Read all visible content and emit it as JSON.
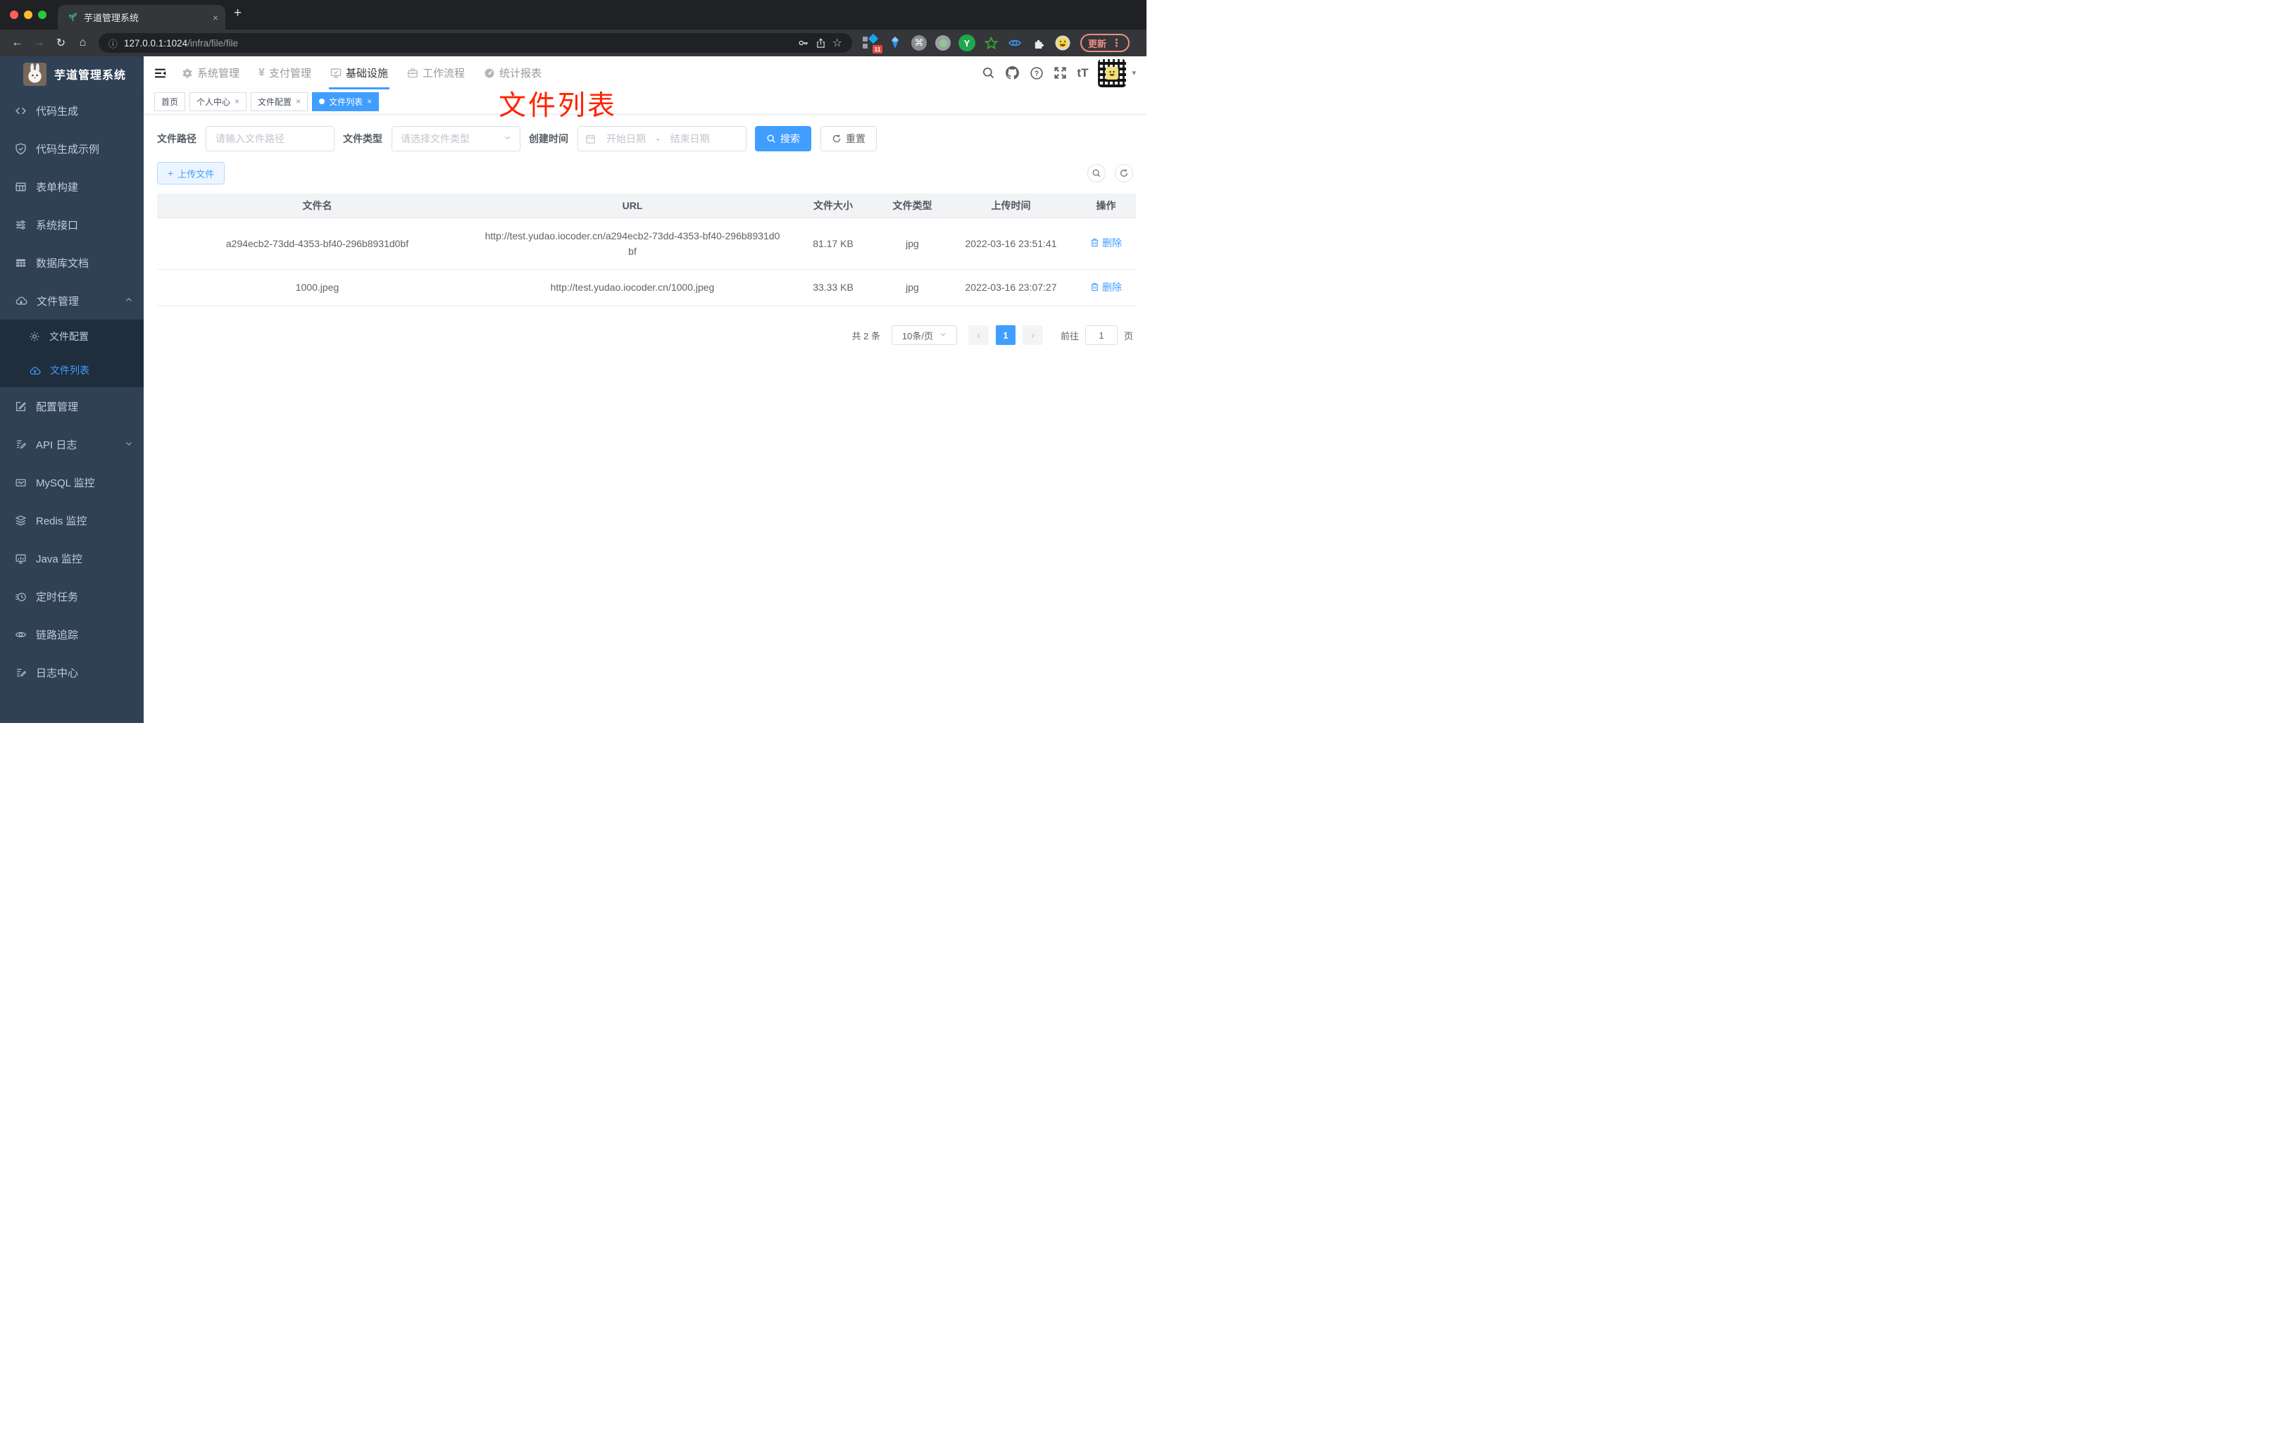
{
  "colors": {
    "accent": "#409eff",
    "sidebar_bg": "#304156",
    "submenu_bg": "#1f2d3d",
    "annotation_red": "#ff2301",
    "table_header_bg": "#f2f3f5"
  },
  "browser": {
    "tab_title": "芋道管理系统",
    "url_host": "127.0.0.1:1024",
    "url_path": "/infra/file/file",
    "update_label": "更新",
    "extensions": [
      {
        "name": "extension-badge",
        "badge": "11"
      },
      {
        "name": "extension-command",
        "char": "⌘"
      },
      {
        "name": "extension-y",
        "char": "Y"
      }
    ]
  },
  "icons": {
    "close": "×",
    "plus": "+",
    "back": "←",
    "forward": "→",
    "reload": "↻",
    "home": "⌂",
    "info": "ⓘ",
    "star": "☆",
    "kebab": "⋮",
    "caret": "▾",
    "chevron_left": "‹",
    "chevron_right": "›",
    "question": "?",
    "yen": "¥",
    "font_size": "tT"
  },
  "sidebar": {
    "title": "芋道管理系统",
    "items": [
      {
        "label": "代码生成"
      },
      {
        "label": "代码生成示例"
      },
      {
        "label": "表单构建"
      },
      {
        "label": "系统接口"
      },
      {
        "label": "数据库文档"
      },
      {
        "label": "文件管理",
        "children": [
          {
            "label": "文件配置"
          },
          {
            "label": "文件列表"
          }
        ]
      },
      {
        "label": "配置管理"
      },
      {
        "label": "API 日志"
      },
      {
        "label": "MySQL 监控"
      },
      {
        "label": "Redis 监控"
      },
      {
        "label": "Java 监控"
      },
      {
        "label": "定时任务"
      },
      {
        "label": "链路追踪"
      },
      {
        "label": "日志中心"
      }
    ]
  },
  "header": {
    "nav": [
      {
        "label": "系统管理"
      },
      {
        "label": "支付管理"
      },
      {
        "label": "基础设施"
      },
      {
        "label": "工作流程"
      },
      {
        "label": "统计报表"
      }
    ]
  },
  "tags": [
    {
      "label": "首页"
    },
    {
      "label": "个人中心"
    },
    {
      "label": "文件配置"
    },
    {
      "label": "文件列表"
    }
  ],
  "annotation": {
    "text": "文件列表"
  },
  "filters": {
    "path_label": "文件路径",
    "path_placeholder": "请输入文件路径",
    "type_label": "文件类型",
    "type_placeholder": "请选择文件类型",
    "date_label": "创建时间",
    "date_start_placeholder": "开始日期",
    "date_separator": "-",
    "date_end_placeholder": "结束日期",
    "search_label": "搜索",
    "reset_label": "重置"
  },
  "toolbar": {
    "upload_label": "上传文件"
  },
  "table": {
    "headers": [
      "文件名",
      "URL",
      "文件大小",
      "文件类型",
      "上传时间",
      "操作"
    ],
    "rows": [
      {
        "name": "a294ecb2-73dd-4353-bf40-296b8931d0bf",
        "url": "http://test.yudao.iocoder.cn/a294ecb2-73dd-4353-bf40-296b8931d0bf",
        "size": "81.17 KB",
        "type": "jpg",
        "time": "2022-03-16 23:51:41",
        "action": "删除"
      },
      {
        "name": "1000.jpeg",
        "url": "http://test.yudao.iocoder.cn/1000.jpeg",
        "size": "33.33 KB",
        "type": "jpg",
        "time": "2022-03-16 23:07:27",
        "action": "删除"
      }
    ]
  },
  "pagination": {
    "total": "共 2 条",
    "page_size": "10条/页",
    "current_page": "1",
    "goto_label": "前往",
    "goto_value": "1",
    "unit_label": "页"
  }
}
